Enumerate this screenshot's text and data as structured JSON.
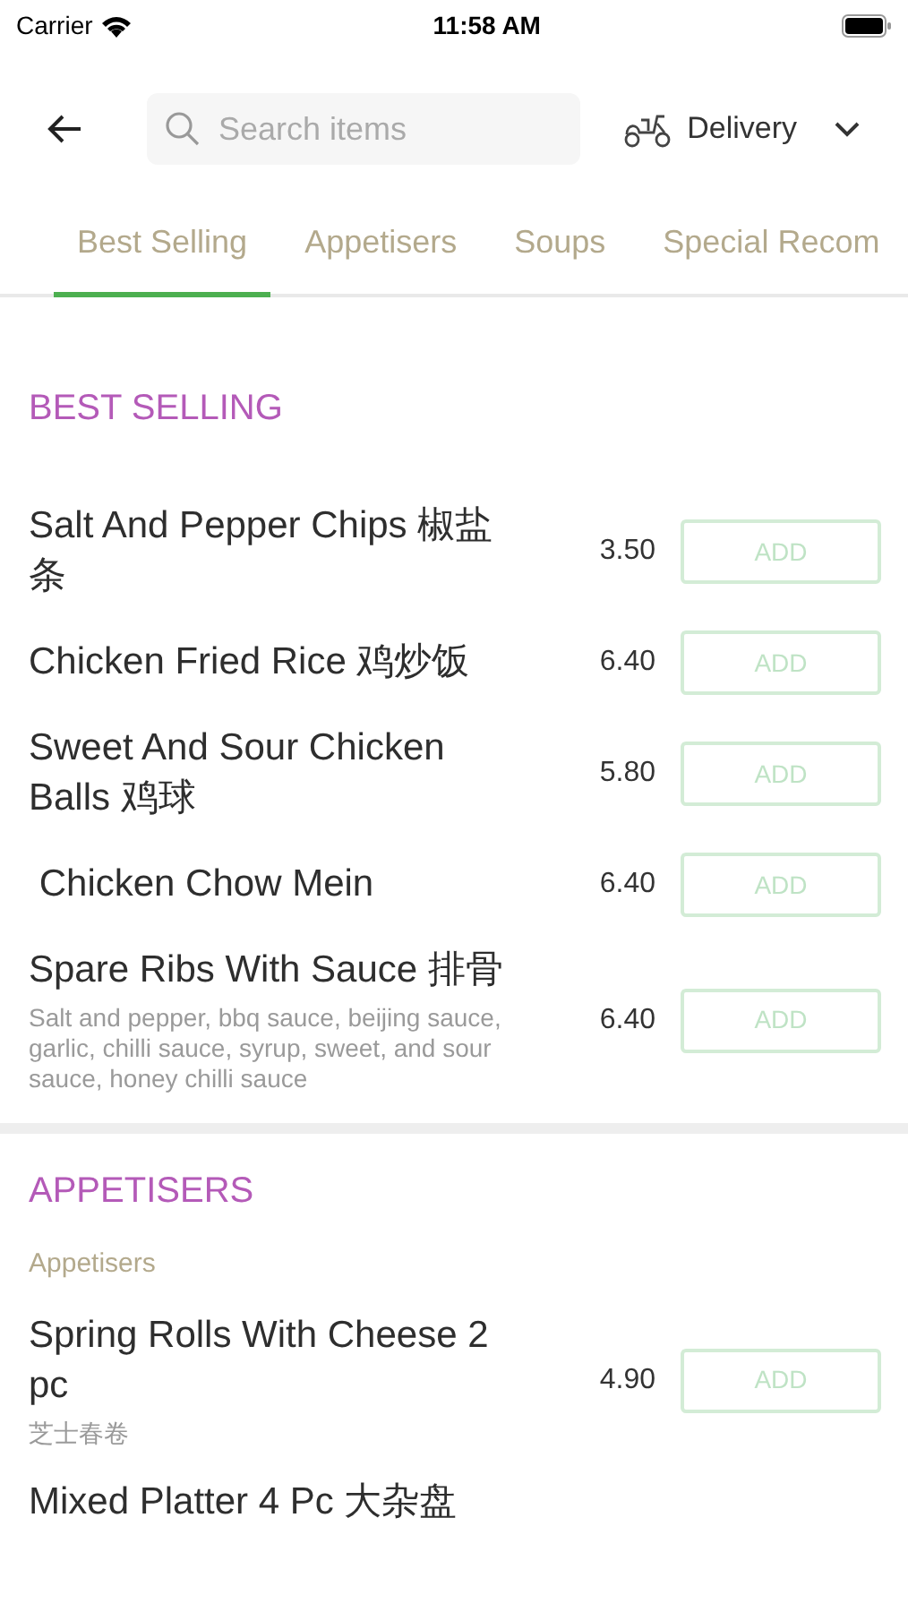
{
  "status_bar": {
    "carrier": "Carrier",
    "time": "11:58 AM"
  },
  "header": {
    "search": {
      "placeholder": "Search items"
    },
    "mode": "Delivery"
  },
  "tabs": [
    {
      "label": "Best Selling",
      "selected": true
    },
    {
      "label": "Appetisers",
      "selected": false
    },
    {
      "label": "Soups",
      "selected": false
    },
    {
      "label": "Special Recom",
      "selected": false
    }
  ],
  "sections": [
    {
      "title": "BEST SELLING",
      "items": [
        {
          "name": "Salt And Pepper Chips 椒盐条",
          "price": "3.50",
          "button": "ADD"
        },
        {
          "name": "Chicken Fried Rice 鸡炒饭",
          "price": "6.40",
          "button": "ADD"
        },
        {
          "name": "Sweet And Sour Chicken Balls 鸡球",
          "price": "5.80",
          "button": "ADD"
        },
        {
          "name": " Chicken Chow Mein",
          "price": "6.40",
          "button": "ADD"
        },
        {
          "name": "Spare Ribs With Sauce 排骨",
          "description": "Salt and pepper, bbq sauce, beijing sauce, garlic, chilli sauce, syrup, sweet, and sour sauce, honey chilli sauce",
          "price": "6.40",
          "button": "ADD"
        }
      ]
    },
    {
      "title": "APPETISERS",
      "subtitle": "Appetisers",
      "items": [
        {
          "name": "Spring Rolls With Cheese 2 pc",
          "description": "芝士春卷",
          "price": "4.90",
          "button": "ADD"
        },
        {
          "name": "Mixed Platter 4 Pc 大杂盘"
        }
      ]
    }
  ]
}
